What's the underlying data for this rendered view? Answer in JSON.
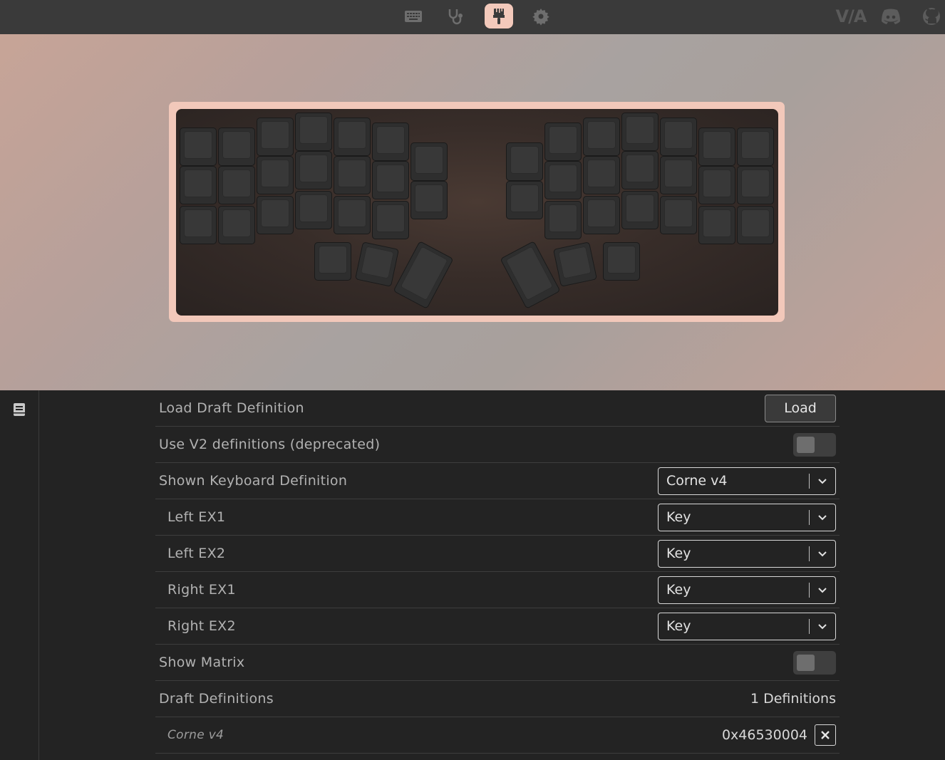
{
  "nav": {
    "items": [
      {
        "name": "keyboard-icon",
        "active": false
      },
      {
        "name": "stethoscope-icon",
        "active": false
      },
      {
        "name": "paintbrush-icon",
        "active": true
      },
      {
        "name": "gear-icon",
        "active": false
      }
    ],
    "links": [
      "via-logo",
      "discord-icon",
      "github-icon"
    ],
    "via_label": "V/A"
  },
  "colors": {
    "accent": "#f3c9bb",
    "topbar": "#3a3a3a",
    "panel_bg": "#232323"
  },
  "sidebar": {
    "icon": "book-icon"
  },
  "settings": {
    "load_draft": {
      "label": "Load Draft Definition",
      "button": "Load"
    },
    "use_v2": {
      "label": "Use V2 definitions (deprecated)",
      "enabled": false
    },
    "shown_definition": {
      "label": "Shown Keyboard Definition",
      "value": "Corne v4"
    },
    "left_ex1": {
      "label": "Left EX1",
      "value": "Key"
    },
    "left_ex2": {
      "label": "Left EX2",
      "value": "Key"
    },
    "right_ex1": {
      "label": "Right EX1",
      "value": "Key"
    },
    "right_ex2": {
      "label": "Right EX2",
      "value": "Key"
    },
    "show_matrix": {
      "label": "Show Matrix",
      "enabled": false
    },
    "draft_definitions": {
      "label": "Draft Definitions",
      "count": "1 Definitions"
    },
    "definition_item": {
      "name": "Corne v4",
      "id": "0x46530004"
    }
  }
}
